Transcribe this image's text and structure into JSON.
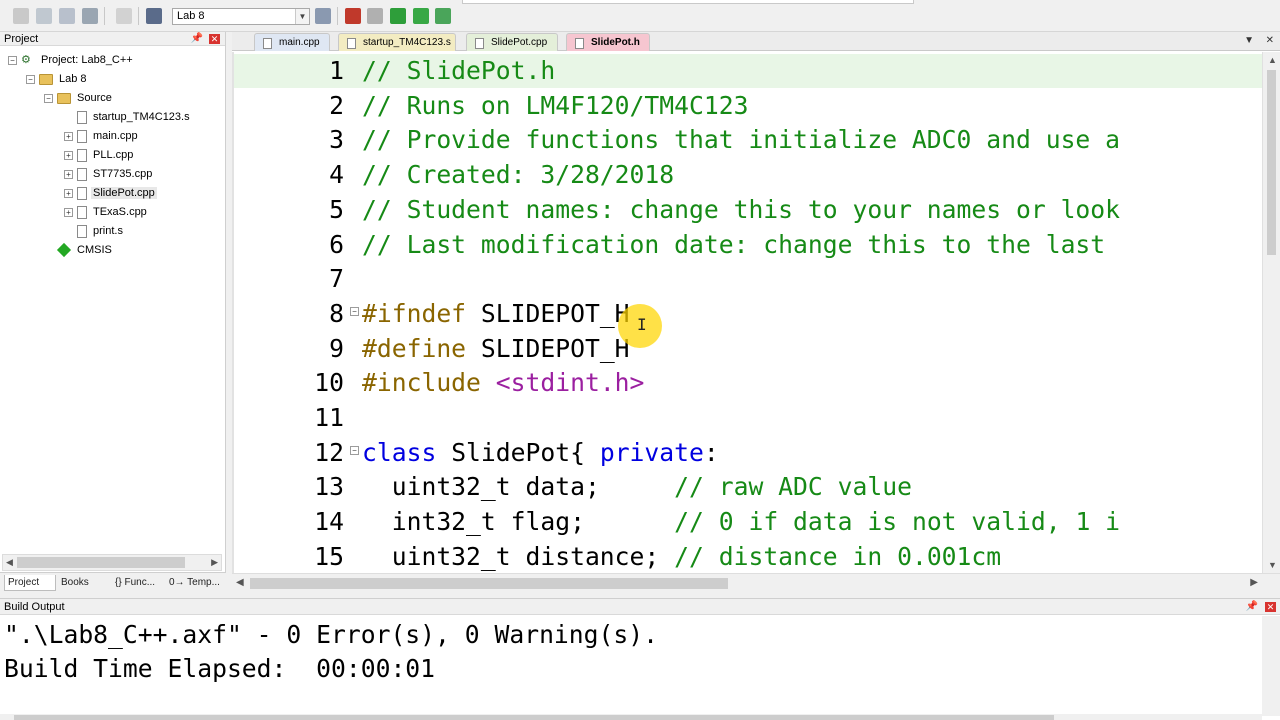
{
  "toolbar": {
    "target_name": "Lab 8"
  },
  "project_panel": {
    "title": "Project",
    "tree": [
      {
        "label": "Project: Lab8_C++",
        "kind": "project",
        "level": 0,
        "expander": "−"
      },
      {
        "label": "Lab 8",
        "kind": "target",
        "level": 1,
        "expander": "−"
      },
      {
        "label": "Source",
        "kind": "folder",
        "level": 2,
        "expander": "−"
      },
      {
        "label": "startup_TM4C123.s",
        "kind": "file",
        "level": 3,
        "expander": ""
      },
      {
        "label": "main.cpp",
        "kind": "file",
        "level": 3,
        "expander": "+"
      },
      {
        "label": "PLL.cpp",
        "kind": "file",
        "level": 3,
        "expander": "+"
      },
      {
        "label": "ST7735.cpp",
        "kind": "file",
        "level": 3,
        "expander": "+"
      },
      {
        "label": "SlidePot.cpp",
        "kind": "file",
        "level": 3,
        "expander": "+",
        "selected": true
      },
      {
        "label": "TExaS.cpp",
        "kind": "file",
        "level": 3,
        "expander": "+"
      },
      {
        "label": "print.s",
        "kind": "file",
        "level": 3,
        "expander": ""
      },
      {
        "label": "CMSIS",
        "kind": "component",
        "level": 2,
        "expander": ""
      }
    ],
    "tabs": [
      "Project",
      "Books",
      "{} Func...",
      "0→ Temp..."
    ]
  },
  "editor": {
    "tabs": [
      {
        "label": "main.cpp",
        "active": false
      },
      {
        "label": "startup_TM4C123.s",
        "active": false
      },
      {
        "label": "SlidePot.cpp",
        "active": false
      },
      {
        "label": "SlidePot.h",
        "active": true
      }
    ],
    "active_line": 1,
    "lines": [
      {
        "n": "1",
        "fold": "",
        "tokens": [
          {
            "t": "// SlidePot.h",
            "c": "comment"
          }
        ]
      },
      {
        "n": "2",
        "fold": "",
        "tokens": [
          {
            "t": "// Runs on LM4F120/TM4C123",
            "c": "comment"
          }
        ]
      },
      {
        "n": "3",
        "fold": "",
        "tokens": [
          {
            "t": "// Provide functions that initialize ADC0 and use a",
            "c": "comment"
          }
        ]
      },
      {
        "n": "4",
        "fold": "",
        "tokens": [
          {
            "t": "// Created: 3/28/2018",
            "c": "comment"
          }
        ]
      },
      {
        "n": "5",
        "fold": "",
        "tokens": [
          {
            "t": "// Student names: change this to your names or look",
            "c": "comment"
          }
        ]
      },
      {
        "n": "6",
        "fold": "",
        "tokens": [
          {
            "t": "// Last modification date: change this to the last",
            "c": "comment"
          }
        ]
      },
      {
        "n": "7",
        "fold": "",
        "tokens": []
      },
      {
        "n": "8",
        "fold": "⊟",
        "tokens": [
          {
            "t": "#ifndef",
            "c": "pre"
          },
          {
            "t": " SLIDEPOT_H",
            "c": "plain"
          }
        ]
      },
      {
        "n": "9",
        "fold": "",
        "tokens": [
          {
            "t": "#define",
            "c": "pre"
          },
          {
            "t": " SLIDEPOT_H",
            "c": "plain"
          }
        ]
      },
      {
        "n": "10",
        "fold": "",
        "tokens": [
          {
            "t": "#include",
            "c": "pre"
          },
          {
            "t": " ",
            "c": "plain"
          },
          {
            "t": "<stdint.h>",
            "c": "str"
          }
        ]
      },
      {
        "n": "11",
        "fold": "",
        "tokens": []
      },
      {
        "n": "12",
        "fold": "⊟",
        "tokens": [
          {
            "t": "class",
            "c": "kw"
          },
          {
            "t": " SlidePot{ ",
            "c": "plain"
          },
          {
            "t": "private",
            "c": "kw"
          },
          {
            "t": ":",
            "c": "plain"
          }
        ]
      },
      {
        "n": "13",
        "fold": "",
        "tokens": [
          {
            "t": "  uint32_t data;     ",
            "c": "plain"
          },
          {
            "t": "// raw ADC value",
            "c": "comment"
          }
        ]
      },
      {
        "n": "14",
        "fold": "",
        "tokens": [
          {
            "t": "  int32_t flag;      ",
            "c": "plain"
          },
          {
            "t": "// 0 if data is not valid, 1 i",
            "c": "comment"
          }
        ]
      },
      {
        "n": "15",
        "fold": "",
        "tokens": [
          {
            "t": "  uint32_t distance; ",
            "c": "plain"
          },
          {
            "t": "// distance in 0.001cm",
            "c": "comment"
          }
        ]
      }
    ]
  },
  "build_output": {
    "title": "Build Output",
    "lines": [
      "\".\\Lab8_C++.axf\" - 0 Error(s), 0 Warning(s).",
      "Build Time Elapsed:  00:00:01"
    ]
  },
  "colors": {
    "comment": "#168a16",
    "preprocessor": "#8a6500",
    "keyword": "#0000e0",
    "string": "#9b1fa0",
    "current_line": "#e8f6e6",
    "active_tab": "#f6c6d0"
  }
}
